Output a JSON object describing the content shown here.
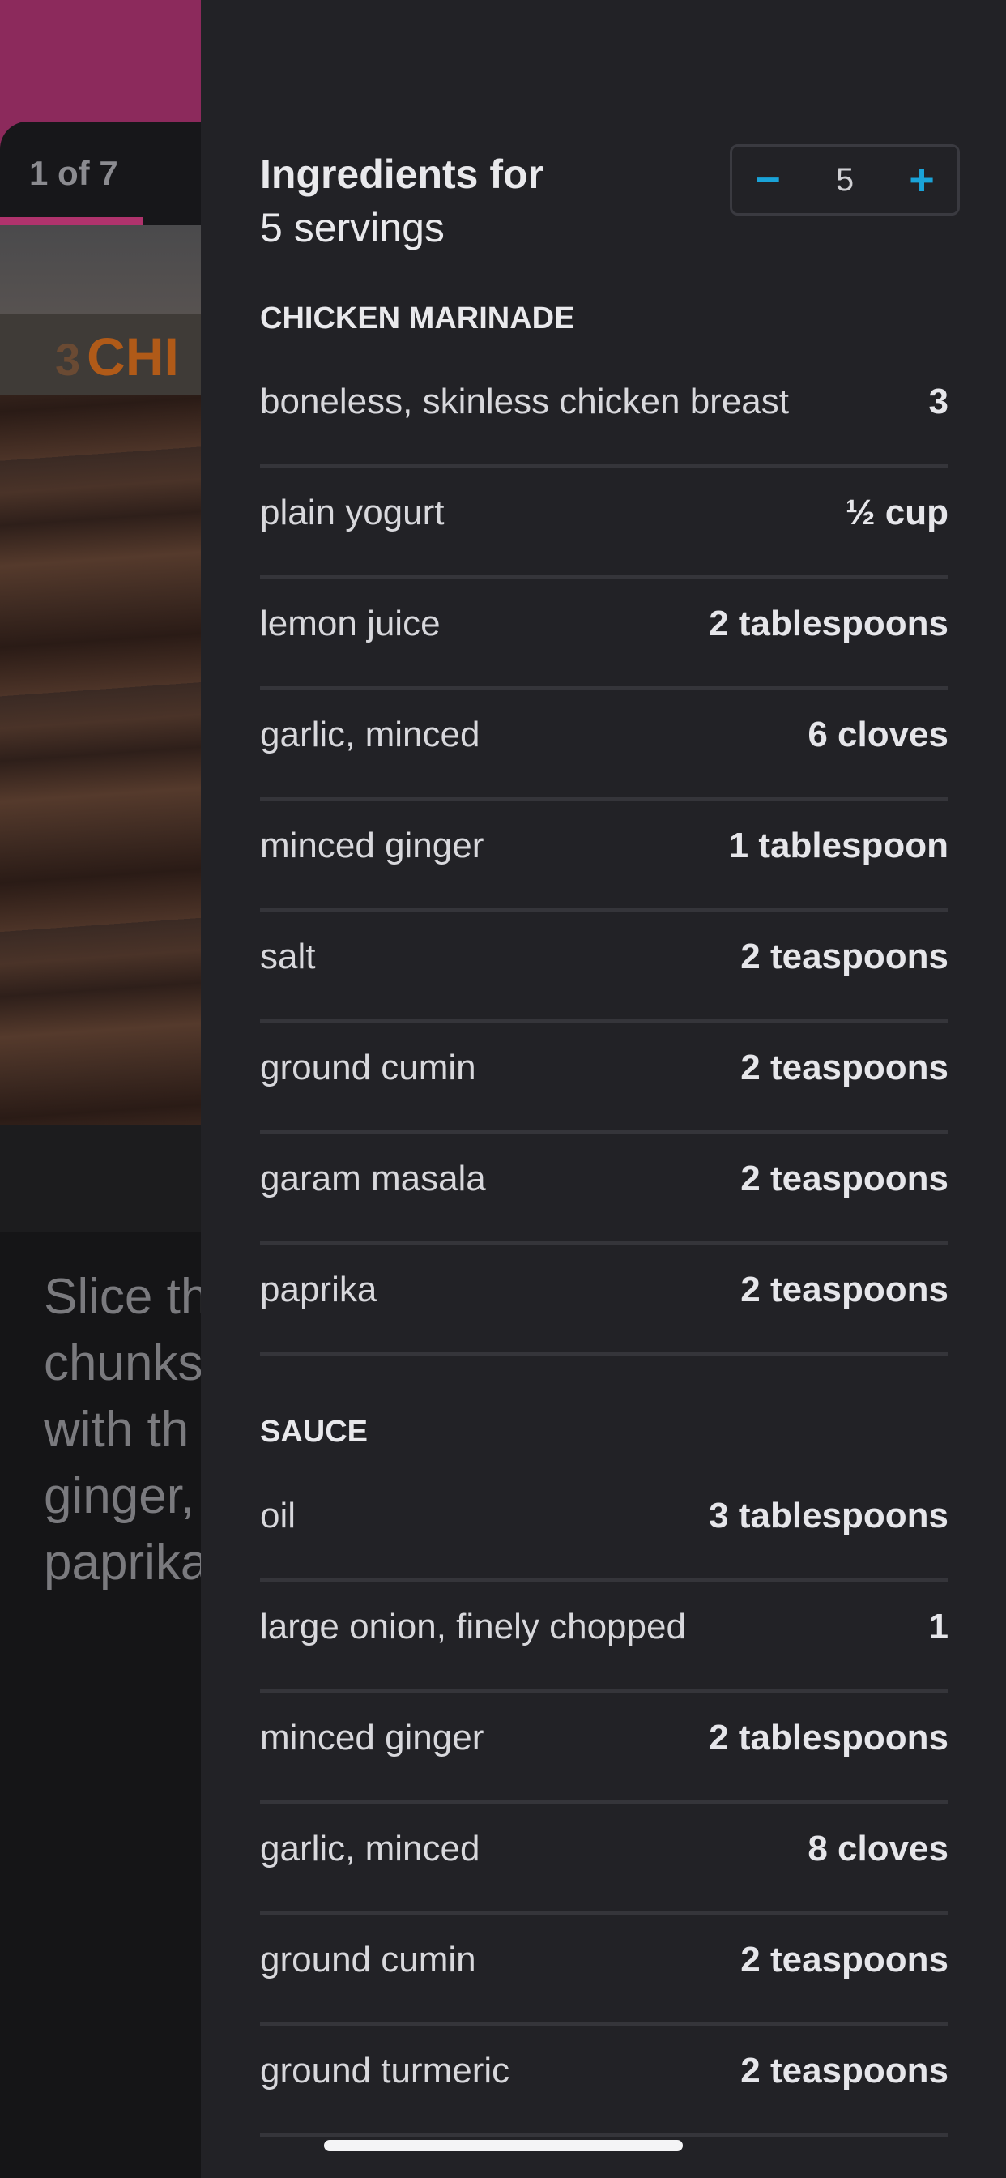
{
  "step_view": {
    "counter": "1 of 7",
    "photo_label_number": "3",
    "photo_label_text": "CHI",
    "step_text": "Slice th\nchunks\nwith th\nginger,\npaprika",
    "accent_color": "#b0336d"
  },
  "ingredients_panel": {
    "title_bold": "Ingredients for",
    "title_servings": "5 servings",
    "servings_stepper": {
      "minus": "−",
      "value": "5",
      "plus": "+",
      "accent_color": "#1aa3d8"
    },
    "sections": [
      {
        "heading": "CHICKEN MARINADE",
        "items": [
          {
            "name": "boneless, skinless chicken breast",
            "qty": "3"
          },
          {
            "name": "plain yogurt",
            "qty": "½ cup"
          },
          {
            "name": "lemon juice",
            "qty": "2 tablespoons"
          },
          {
            "name": "garlic, minced",
            "qty": "6 cloves"
          },
          {
            "name": "minced ginger",
            "qty": "1 tablespoon"
          },
          {
            "name": "salt",
            "qty": "2 teaspoons"
          },
          {
            "name": "ground cumin",
            "qty": "2 teaspoons"
          },
          {
            "name": "garam masala",
            "qty": "2 teaspoons"
          },
          {
            "name": "paprika",
            "qty": "2 teaspoons"
          }
        ]
      },
      {
        "heading": "SAUCE",
        "items": [
          {
            "name": "oil",
            "qty": "3 tablespoons"
          },
          {
            "name": "large onion, finely chopped",
            "qty": "1"
          },
          {
            "name": "minced ginger",
            "qty": "2 tablespoons"
          },
          {
            "name": "garlic, minced",
            "qty": "8 cloves"
          },
          {
            "name": "ground cumin",
            "qty": "2 teaspoons"
          },
          {
            "name": "ground turmeric",
            "qty": "2 teaspoons"
          }
        ]
      }
    ]
  }
}
